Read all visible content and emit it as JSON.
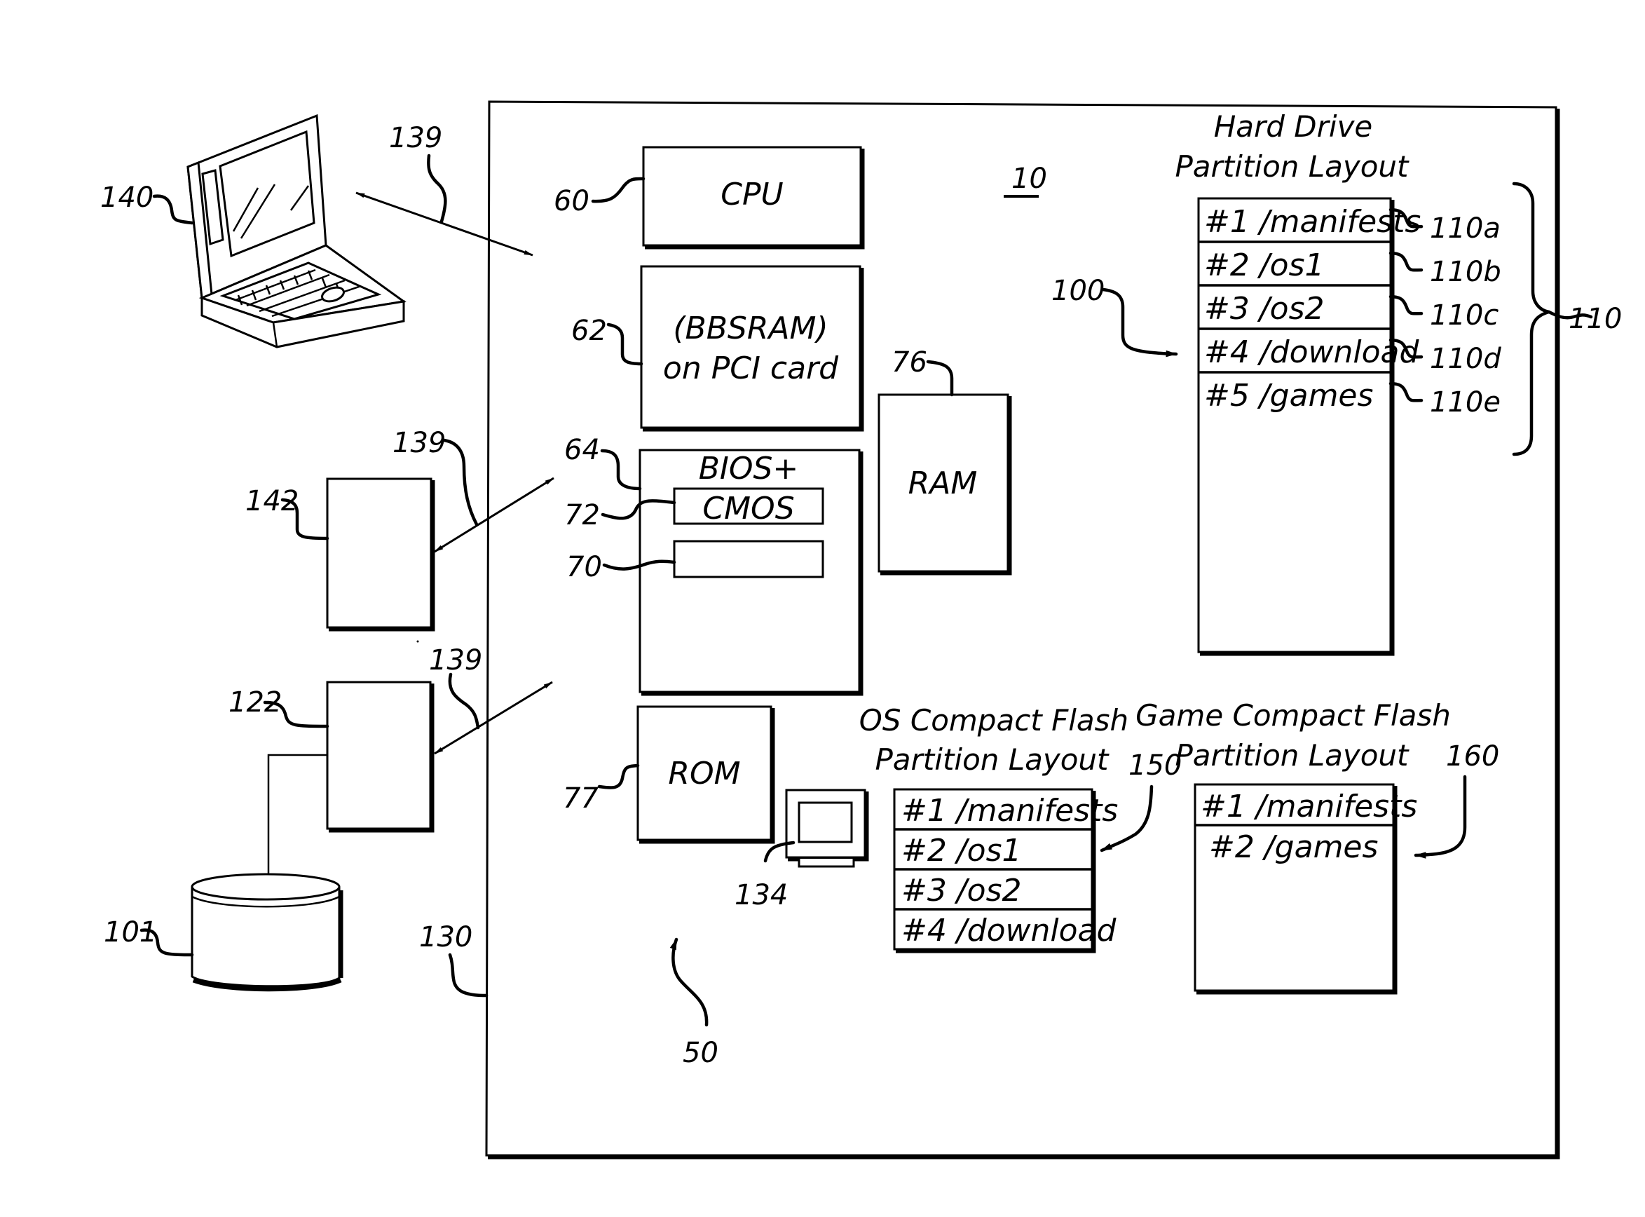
{
  "figure": {
    "system_ref": "10",
    "enclosure_ref": "130",
    "motherboard_ref": "50",
    "colors": {
      "ink": "#000000",
      "paper": "#ffffff"
    }
  },
  "components": {
    "cpu": {
      "label": "CPU",
      "ref": "60"
    },
    "bbsram": {
      "line1": "(BBSRAM)",
      "line2": "on PCI card",
      "ref": "62"
    },
    "bios": {
      "label": "BIOS+",
      "ref": "64"
    },
    "cmos": {
      "label": "CMOS",
      "ref": "72"
    },
    "slot70": {
      "label": "",
      "ref": "70"
    },
    "ram": {
      "label": "RAM",
      "ref": "76"
    },
    "rom": {
      "label": "ROM",
      "ref": "77"
    },
    "monitor": {
      "ref": "134",
      "icon": "monitor-icon"
    }
  },
  "external": {
    "laptop": {
      "ref": "140",
      "icon": "laptop-icon",
      "link_ref": "139"
    },
    "device142": {
      "ref": "142",
      "link_ref": "139"
    },
    "server122": {
      "ref": "122",
      "link_ref": "139"
    },
    "database": {
      "ref": "101",
      "icon": "database-icon"
    }
  },
  "hard_drive": {
    "title_line1": "Hard Drive",
    "title_line2": "Partition Layout",
    "ref": "100",
    "group_ref": "110",
    "partitions": [
      {
        "label": "#1 /manifests",
        "ref": "110a"
      },
      {
        "label": "#2 /os1",
        "ref": "110b"
      },
      {
        "label": "#3 /os2",
        "ref": "110c"
      },
      {
        "label": "#4 /download",
        "ref": "110d"
      },
      {
        "label": "#5 /games",
        "ref": "110e"
      }
    ]
  },
  "os_flash": {
    "title_line1": "OS Compact Flash",
    "title_line2": "Partition Layout",
    "ref": "150",
    "partitions": [
      {
        "label": "#1 /manifests"
      },
      {
        "label": "#2 /os1"
      },
      {
        "label": "#3 /os2"
      },
      {
        "label": "#4 /download"
      }
    ]
  },
  "game_flash": {
    "title_line1": "Game Compact Flash",
    "title_line2": "Partition Layout",
    "ref": "160",
    "partitions": [
      {
        "label": "#1 /manifests"
      },
      {
        "label": "#2 /games"
      }
    ]
  }
}
